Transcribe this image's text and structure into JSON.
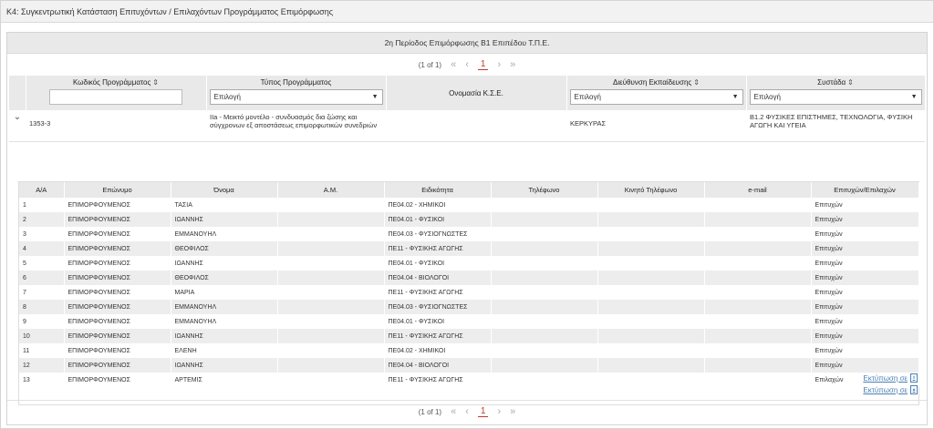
{
  "panel": {
    "title": "K4: Συγκεντρωτική Κατάσταση Επιτυχόντων / Επιλαχόντων Προγράμματος Επιμόρφωσης"
  },
  "caption": "2η Περίοδος Επιμόρφωσης Β1 Επιπέδου Τ.Π.Ε.",
  "pager": {
    "info": "(1 of 1)",
    "first": "«",
    "prev": "‹",
    "current": "1",
    "next": "›",
    "last": "»"
  },
  "columns": {
    "code": "Κωδικός Προγράμματος",
    "type": "Τύπος Προγράμματος",
    "kse": "Ονομασία Κ.Σ.Ε.",
    "directorate": "Διεύθυνση Εκπαίδευσης",
    "cluster": "Συστάδα",
    "select_placeholder": "Επιλογή"
  },
  "program_row": {
    "expander": "⌄",
    "code": "1353-3",
    "type": "IIa - Μεικτό μοντέλο - συνδυασμός δια ζώσης και σύγχρονων εξ αποστάσεως επιμορφωτικών συνεδριών",
    "kse": "",
    "directorate": "ΚΕΡΚΥΡΑΣ",
    "cluster": "Β1.2 ΦΥΣΙΚΕΣ ΕΠΙΣΤΗΜΕΣ, ΤΕΧΝΟΛΟΓΙΑ, ΦΥΣΙΚΗ ΑΓΩΓΗ ΚΑΙ ΥΓΕΙΑ"
  },
  "sub_columns": [
    "Α/Α",
    "Επώνυμο",
    "Όνομα",
    "Α.Μ.",
    "Ειδικότητα",
    "Τηλέφωνο",
    "Κινητό Τηλέφωνο",
    "e-mail",
    "Επιτυχών/Επιλαχών"
  ],
  "sub_rows": [
    [
      "1",
      "ΕΠΙΜΟΡΦΟΥΜΕΝΟΣ",
      "ΤΑΣΙΑ",
      "",
      "ΠΕ04.02 - ΧΗΜΙΚΟΙ",
      "",
      "",
      "",
      "Επιτυχών"
    ],
    [
      "2",
      "ΕΠΙΜΟΡΦΟΥΜΕΝΟΣ",
      "ΙΩΑΝΝΗΣ",
      "",
      "ΠΕ04.01 - ΦΥΣΙΚΟΙ",
      "",
      "",
      "",
      "Επιτυχών"
    ],
    [
      "3",
      "ΕΠΙΜΟΡΦΟΥΜΕΝΟΣ",
      "ΕΜΜΑΝΟΥΗΛ",
      "",
      "ΠΕ04.03 - ΦΥΣΙΟΓΝΩΣΤΕΣ",
      "",
      "",
      "",
      "Επιτυχών"
    ],
    [
      "4",
      "ΕΠΙΜΟΡΦΟΥΜΕΝΟΣ",
      "ΘΕΟΦΙΛΟΣ",
      "",
      "ΠΕ11 - ΦΥΣΙΚΗΣ ΑΓΩΓΗΣ",
      "",
      "",
      "",
      "Επιτυχών"
    ],
    [
      "5",
      "ΕΠΙΜΟΡΦΟΥΜΕΝΟΣ",
      "ΙΩΑΝΝΗΣ",
      "",
      "ΠΕ04.01 - ΦΥΣΙΚΟΙ",
      "",
      "",
      "",
      "Επιτυχών"
    ],
    [
      "6",
      "ΕΠΙΜΟΡΦΟΥΜΕΝΟΣ",
      "ΘΕΟΦΙΛΟΣ",
      "",
      "ΠΕ04.04 - ΒΙΟΛΟΓΟΙ",
      "",
      "",
      "",
      "Επιτυχών"
    ],
    [
      "7",
      "ΕΠΙΜΟΡΦΟΥΜΕΝΟΣ",
      "ΜΑΡΙΑ",
      "",
      "ΠΕ11 - ΦΥΣΙΚΗΣ ΑΓΩΓΗΣ",
      "",
      "",
      "",
      "Επιτυχών"
    ],
    [
      "8",
      "ΕΠΙΜΟΡΦΟΥΜΕΝΟΣ",
      "ΕΜΜΑΝΟΥΗΛ",
      "",
      "ΠΕ04.03 - ΦΥΣΙΟΓΝΩΣΤΕΣ",
      "",
      "",
      "",
      "Επιτυχών"
    ],
    [
      "9",
      "ΕΠΙΜΟΡΦΟΥΜΕΝΟΣ",
      "ΕΜΜΑΝΟΥΗΛ",
      "",
      "ΠΕ04.01 - ΦΥΣΙΚΟΙ",
      "",
      "",
      "",
      "Επιτυχών"
    ],
    [
      "10",
      "ΕΠΙΜΟΡΦΟΥΜΕΝΟΣ",
      "ΙΩΑΝΝΗΣ",
      "",
      "ΠΕ11 - ΦΥΣΙΚΗΣ ΑΓΩΓΗΣ",
      "",
      "",
      "",
      "Επιτυχών"
    ],
    [
      "11",
      "ΕΠΙΜΟΡΦΟΥΜΕΝΟΣ",
      "ΕΛΕΝΗ",
      "",
      "ΠΕ04.02 - ΧΗΜΙΚΟΙ",
      "",
      "",
      "",
      "Επιτυχών"
    ],
    [
      "12",
      "ΕΠΙΜΟΡΦΟΥΜΕΝΟΣ",
      "ΙΩΑΝΝΗΣ",
      "",
      "ΠΕ04.04 - ΒΙΟΛΟΓΟΙ",
      "",
      "",
      "",
      "Επιτυχών"
    ],
    [
      "13",
      "ΕΠΙΜΟΡΦΟΥΜΕΝΟΣ",
      "ΑΡΤΕΜΙΣ",
      "",
      "ΠΕ11 - ΦΥΣΙΚΗΣ ΑΓΩΓΗΣ",
      "",
      "",
      "",
      "Επιλαχών"
    ]
  ],
  "export": {
    "excel_label": "Εκτύπωση σε",
    "pdf_label": "Εκτύπωση σε",
    "excel_icon": "excel-file-icon",
    "pdf_icon": "pdf-file-icon"
  }
}
